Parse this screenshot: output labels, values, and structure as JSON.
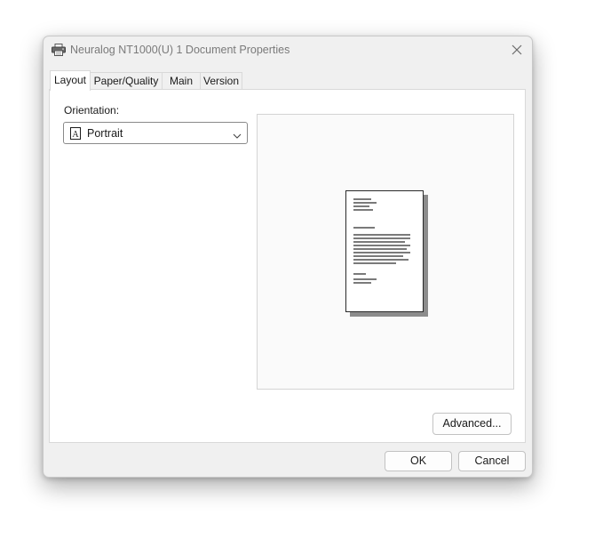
{
  "window": {
    "title": "Neuralog NT1000(U) 1 Document Properties",
    "title_icon": "printer-icon",
    "close_icon": "close-icon"
  },
  "tabs": [
    {
      "label": "Layout",
      "active": true
    },
    {
      "label": "Paper/Quality",
      "active": false
    },
    {
      "label": "Main",
      "active": false
    },
    {
      "label": "Version",
      "active": false
    }
  ],
  "layout": {
    "orientation_label": "Orientation:",
    "orientation_value": "Portrait",
    "orientation_icon": "portrait-page-icon",
    "dropdown_icon": "chevron-down-icon",
    "preview_icon": "document-preview-icon",
    "advanced_label": "Advanced..."
  },
  "footer": {
    "ok_label": "OK",
    "cancel_label": "Cancel"
  },
  "colors": {
    "dialog_bg": "#f0f0f0",
    "panel_bg": "#ffffff",
    "border": "#d9d9d9",
    "title_text": "#7a7a7a"
  }
}
